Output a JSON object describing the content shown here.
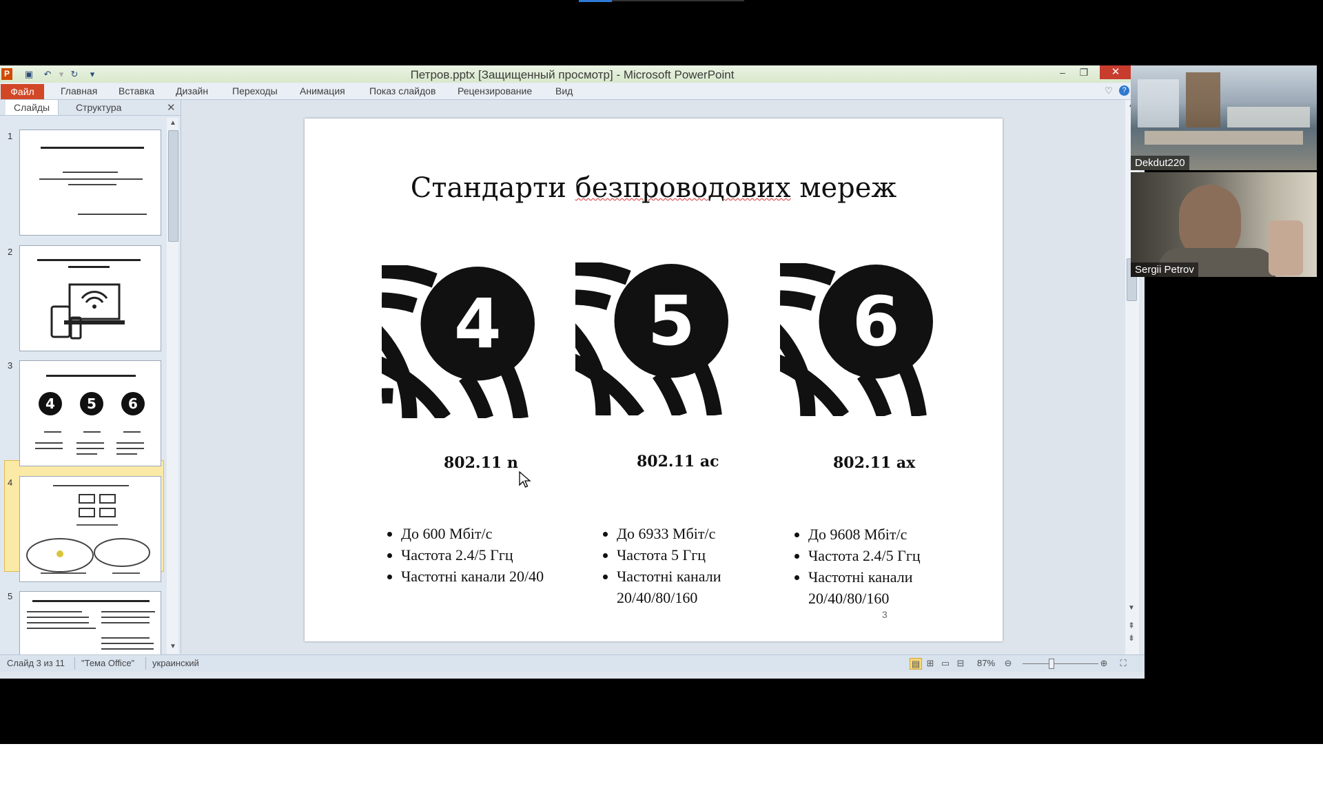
{
  "app": {
    "window_title": "Петров.pptx [Защищенный просмотр]  -  Microsoft PowerPoint",
    "file_tab": "Файл",
    "ribbon_tabs": [
      "Главная",
      "Вставка",
      "Дизайн",
      "Переходы",
      "Анимация",
      "Показ слайдов",
      "Рецензирование",
      "Вид"
    ]
  },
  "left_pane": {
    "tabs": [
      "Слайды",
      "Структура"
    ],
    "slide_numbers": [
      "1",
      "2",
      "3",
      "4",
      "5"
    ],
    "selected_slide": 3
  },
  "slide": {
    "title": "Стандарти безпроводових мереж",
    "standards": [
      {
        "badge": "4",
        "name": "802.11 n",
        "bullets": [
          "До 600 Мбіт/с",
          "Частота 2.4/5 Ггц",
          "Частотні канали 20/40"
        ]
      },
      {
        "badge": "5",
        "name": "802.11 ac",
        "bullets": [
          "До 6933 Мбіт/с",
          "Частота  5 Ггц",
          "Частотні канали 20/40/80/160"
        ]
      },
      {
        "badge": "6",
        "name": "802.11 ax",
        "bullets": [
          "До 9608 Мбіт/с",
          "Частота 2.4/5 Ггц",
          "Частотні канали 20/40/80/160"
        ]
      }
    ],
    "page_number": "3"
  },
  "statusbar": {
    "slide_info": "Слайд 3 из 11",
    "theme": "\"Тема Office\"",
    "language": "украинский",
    "zoom": "87%"
  },
  "participants": [
    {
      "name": "Dekdut220"
    },
    {
      "name": "Sergii Petrov"
    }
  ],
  "colors": {
    "file_tab": "#d24726",
    "close_button": "#c83c2e",
    "selection": "#fbe9a6"
  }
}
